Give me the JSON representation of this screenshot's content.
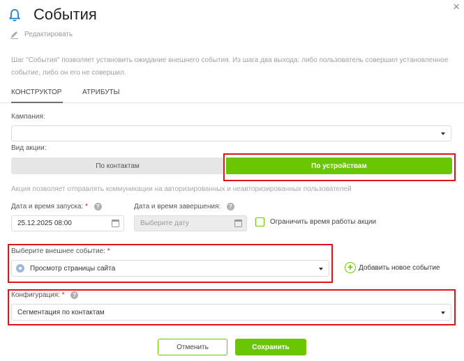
{
  "header": {
    "title": "События",
    "edit_label": "Редактировать",
    "close_symbol": "×",
    "icon": "bell-icon"
  },
  "description": "Шаг \"События\" позволяет установить ожидание внешнего события. Из шага два выхода: либо пользователь совершил установленное событие, либо он его не совершил.",
  "tabs": [
    {
      "label": "КОНСТРУКТОР",
      "active": true
    },
    {
      "label": "АТРИБУТЫ",
      "active": false
    }
  ],
  "form": {
    "campaign_label": "Кампания:",
    "campaign_value": "",
    "action_type_label": "Вид акции:",
    "action_types": [
      {
        "label": "По контактам",
        "selected": false
      },
      {
        "label": "По устройствам",
        "selected": true
      }
    ],
    "action_info": "Акция позволяет отправлять коммуникации на авторизированных и неавторизированных пользователей",
    "start_label": "Дата и время запуска:",
    "start_value": "25.12.2025 08:00",
    "end_label": "Дата и время завершения:",
    "end_placeholder": "Выберите дату",
    "limit_label": "Ограничить время работы акции",
    "limit_checked": false,
    "event_label": "Выберите внешнее событие:",
    "event_value": "Просмотр страницы сайта",
    "add_event_label": "Добавить новое событие",
    "config_label": "Конфигурация:",
    "config_value": "Сегментация по контактам",
    "required_mark": "*",
    "help_mark": "?"
  },
  "footer": {
    "cancel_label": "Отменить",
    "save_label": "Сохранить"
  },
  "colors": {
    "accent": "#6ac600",
    "highlight": "#e0121b",
    "bell": "#1a7fd1"
  }
}
